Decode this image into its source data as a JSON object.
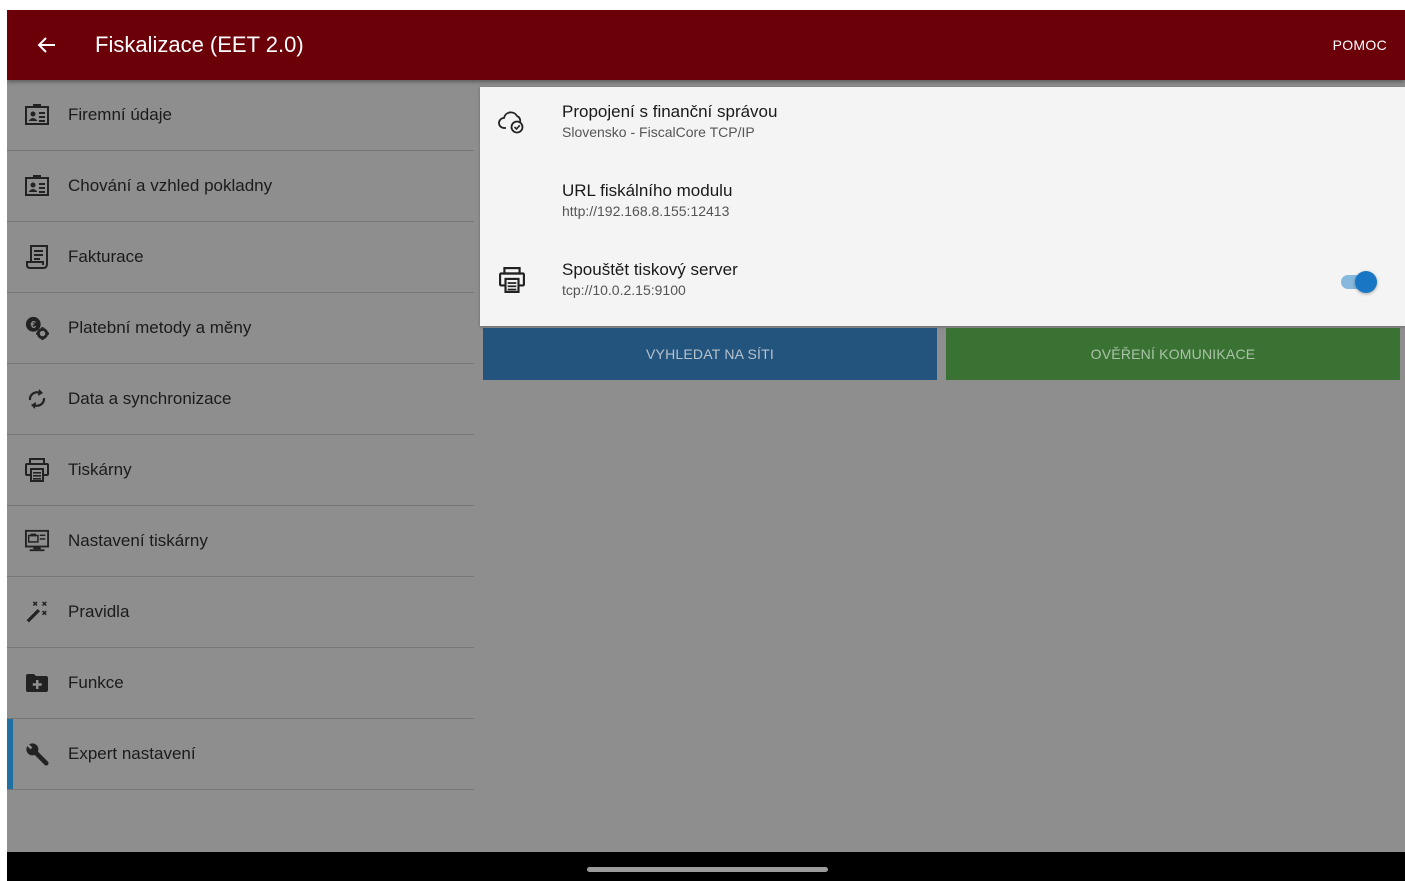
{
  "app_bar": {
    "title": "Fiskalizace (EET 2.0)",
    "help_label": "POMOC",
    "back_icon": "arrow-left-icon",
    "background_color": "#6b0009"
  },
  "sidebar": {
    "items": [
      {
        "label": "Firemní údaje",
        "icon": "id-card-icon"
      },
      {
        "label": "Chování a vzhled pokladny",
        "icon": "id-card-icon"
      },
      {
        "label": "Fakturace",
        "icon": "invoice-icon"
      },
      {
        "label": "Platební metody a měny",
        "icon": "euro-gear-icon"
      },
      {
        "label": "Data a synchronizace",
        "icon": "sync-icon"
      },
      {
        "label": "Tiskárny",
        "icon": "printer-icon"
      },
      {
        "label": "Nastavení tiskárny",
        "icon": "printer-settings-icon"
      },
      {
        "label": "Pravidla",
        "icon": "magic-wand-icon"
      },
      {
        "label": "Funkce",
        "icon": "folder-plus-icon"
      },
      {
        "label": "Expert nastavení",
        "icon": "wrench-icon",
        "active": true
      }
    ],
    "active_color": "#1f6fa3"
  },
  "settings": [
    {
      "title": "Propojení s finanční správou",
      "subtitle": "Slovensko - FiscalCore TCP/IP",
      "icon": "cloud-check-icon"
    },
    {
      "title": "URL fiskálního modulu",
      "subtitle": "http://192.168.8.155:12413",
      "icon": ""
    },
    {
      "title": "Spouštět tiskový server",
      "subtitle": "tcp://10.0.2.15:9100",
      "icon": "printer-icon",
      "toggle_on": true
    }
  ],
  "buttons": {
    "search_label": "VYHLEDAT NA SÍTI",
    "verify_label": "OVĚŘENÍ KOMUNIKACE",
    "search_color": "#23547e",
    "verify_color": "#3a7234"
  }
}
